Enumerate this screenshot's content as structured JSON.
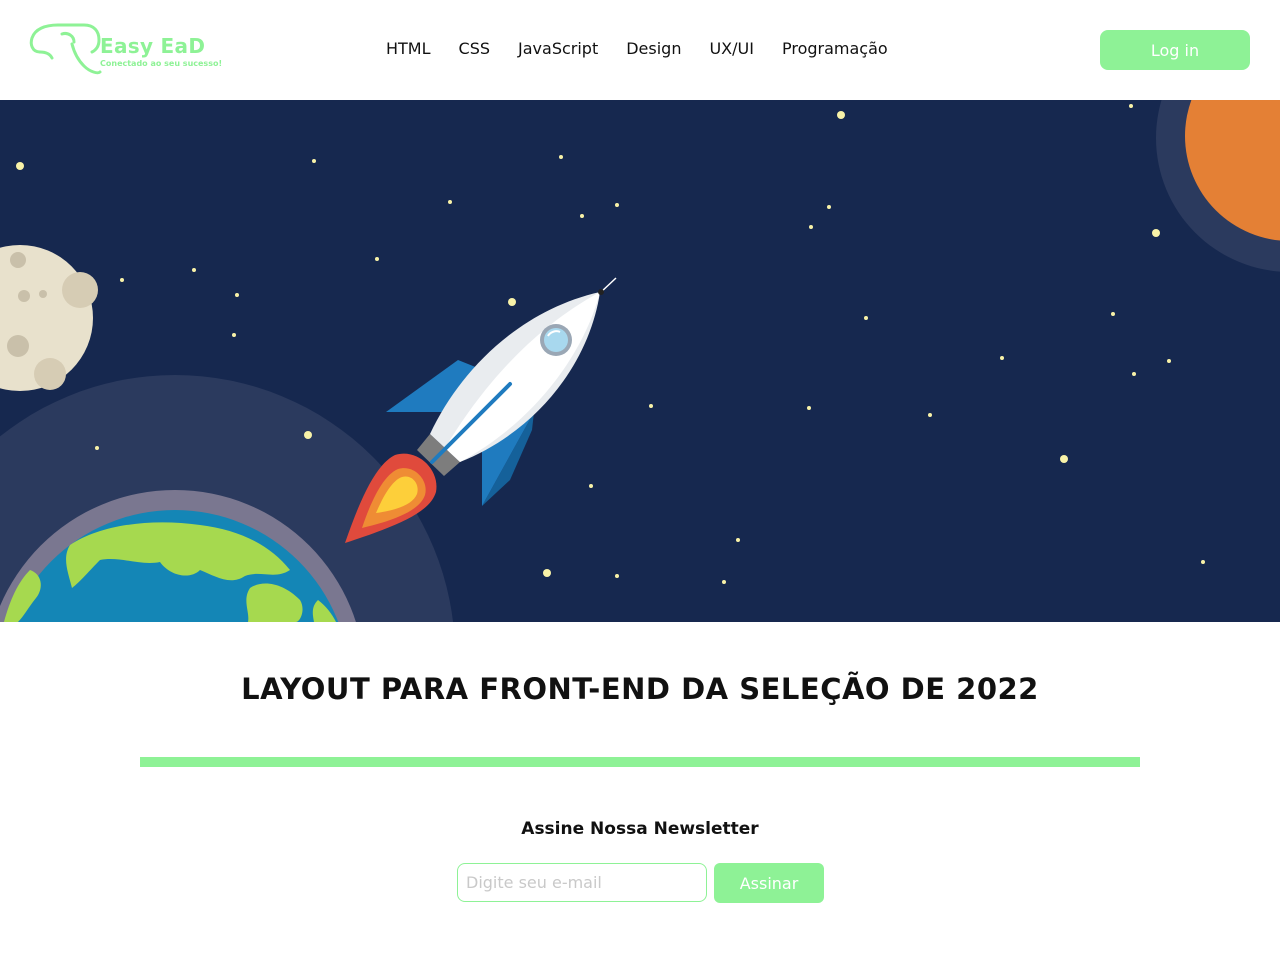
{
  "colors": {
    "accent": "#8ef296",
    "hero_background": "#16284f",
    "star": "#f8f2a8",
    "planet_orange": "#e48035",
    "moon": "#e8e1cc",
    "ocean": "#1486b6",
    "land": "#a6d94f"
  },
  "logo": {
    "name": "Easy EaD",
    "tagline": "Conectado ao seu sucesso!",
    "icon": "elephant-outline-icon"
  },
  "nav": {
    "items": [
      "HTML",
      "CSS",
      "JavaScript",
      "Design",
      "UX/UI",
      "Programação"
    ]
  },
  "header": {
    "login_label": "Log in"
  },
  "hero": {
    "illustration": "rocket-launch-space-illustration"
  },
  "main": {
    "title": "LAYOUT PARA FRONT-END DA SELEÇÃO DE 2022"
  },
  "newsletter": {
    "title": "Assine Nossa Newsletter",
    "placeholder": "Digite seu e-mail",
    "value": "",
    "button_label": "Assinar"
  }
}
